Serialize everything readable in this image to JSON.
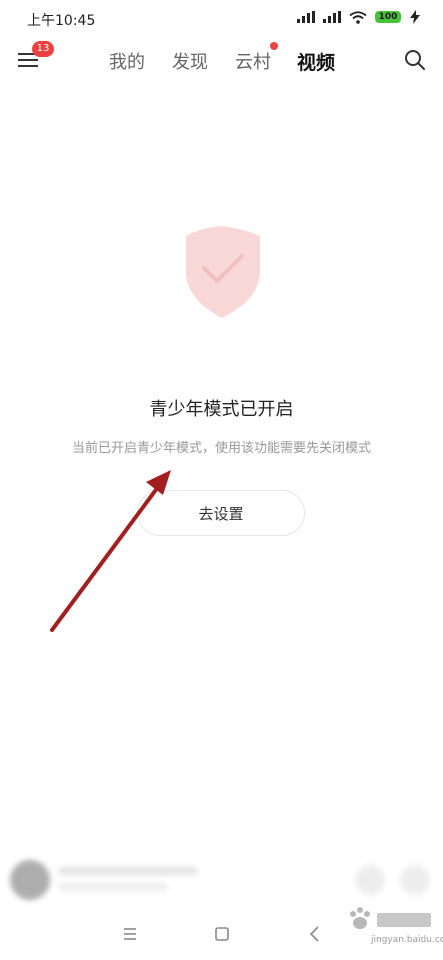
{
  "status_bar": {
    "time": "上午10:45",
    "battery": "100"
  },
  "header": {
    "menu_badge": "13",
    "tabs": [
      {
        "label": "我的",
        "active": false
      },
      {
        "label": "发现",
        "active": false
      },
      {
        "label": "云村",
        "active": false,
        "dot": true
      },
      {
        "label": "视频",
        "active": true
      }
    ]
  },
  "teen_mode": {
    "title": "青少年模式已开启",
    "subtitle": "当前已开启青少年模式，使用该功能需要先关闭模式",
    "button_label": "去设置"
  },
  "watermark": {
    "site": "jingyan.baidu.com"
  },
  "colors": {
    "accent": "#ec4141",
    "arrow": "#a31f1f",
    "battery": "#49c13a",
    "shield": "#f4b7b7"
  }
}
